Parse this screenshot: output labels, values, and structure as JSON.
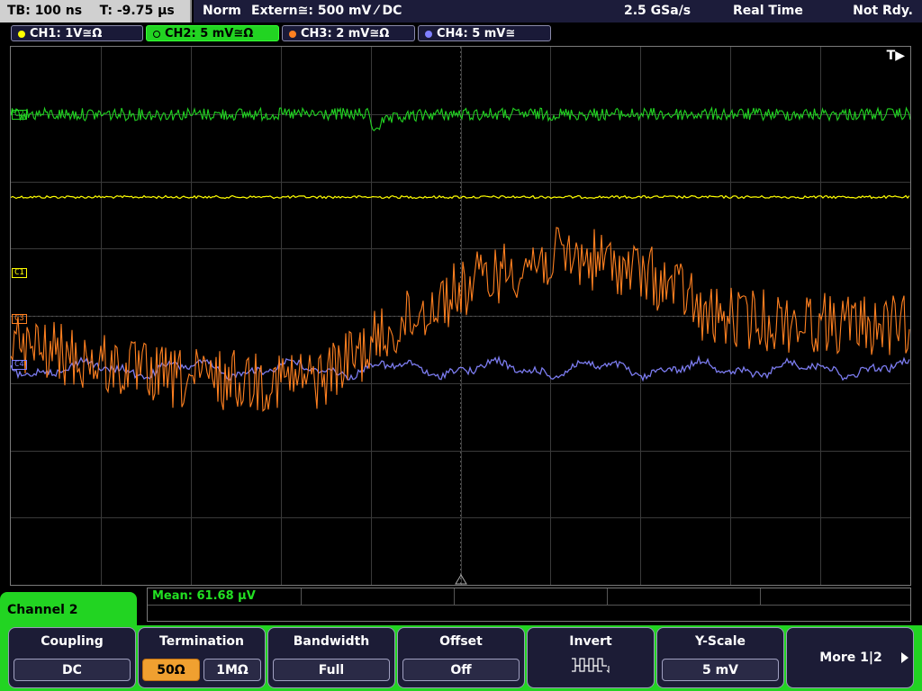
{
  "status": {
    "timebase": "TB: 100 ns",
    "trigger_time": "T: -9.75 µs",
    "mode": "Norm",
    "trigger_source": "Extern≅: 500 mV ⁄ DC",
    "sample_rate": "2.5 GSa/s",
    "acq_mode": "Real Time",
    "state": "Not Rdy."
  },
  "channels": [
    {
      "label": "CH1: 1V≅Ω",
      "color": "#ffff00",
      "active": false
    },
    {
      "label": "CH2: 5 mV≅Ω",
      "color": "#22d422",
      "active": true
    },
    {
      "label": "CH3: 2 mV≅Ω",
      "color": "#ff8020",
      "active": false
    },
    {
      "label": "CH4: 5 mV≅",
      "color": "#8080ff",
      "active": false
    }
  ],
  "screen": {
    "trigger_label": "T▶",
    "markers": [
      {
        "text": "C1",
        "color": "#ffff00"
      },
      {
        "text": "C3",
        "color": "#ff8020"
      },
      {
        "text": "C2",
        "color": "#22d422"
      },
      {
        "text": "C4",
        "color": "#8080ff"
      }
    ]
  },
  "measurement": {
    "label": "Mean: 61.68 µV"
  },
  "panel": {
    "title": "Channel 2",
    "softkeys": [
      {
        "title": "Coupling",
        "values": [
          "DC"
        ]
      },
      {
        "title": "Termination",
        "values": [
          "50Ω",
          "1MΩ"
        ],
        "selected": "50Ω"
      },
      {
        "title": "Bandwidth",
        "values": [
          "Full"
        ]
      },
      {
        "title": "Offset",
        "values": [
          "Off"
        ]
      },
      {
        "title": "Invert",
        "values": []
      },
      {
        "title": "Y-Scale",
        "values": [
          "5 mV"
        ]
      },
      {
        "title": "More 1|2",
        "values": []
      }
    ]
  },
  "icons": {
    "invert": "invert-square-wave-icon",
    "more": "arrow-right-icon",
    "trigger_level": "trigger-level-triangle-icon"
  }
}
